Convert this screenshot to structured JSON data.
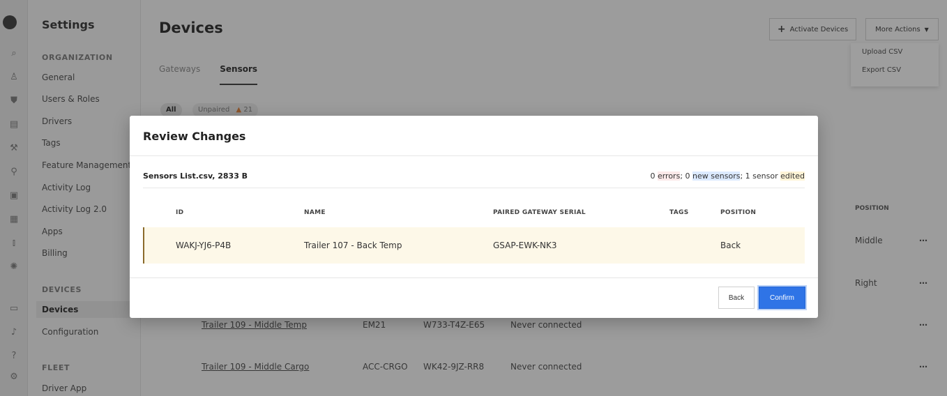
{
  "sidebar": {
    "title": "Settings",
    "organization_label": "ORGANIZATION",
    "org_items": [
      "General",
      "Users & Roles",
      "Drivers",
      "Tags",
      "Feature Management",
      "Activity Log",
      "Activity Log 2.0",
      "Apps",
      "Billing"
    ],
    "devices_label": "DEVICES",
    "device_items": [
      "Devices",
      "Configuration"
    ],
    "fleet_label": "FLEET",
    "fleet_items": [
      "Driver App"
    ]
  },
  "header": {
    "title": "Devices",
    "activate_label": "Activate Devices",
    "more_actions_label": "More Actions"
  },
  "more_actions_menu": [
    "Upload CSV",
    "Export CSV"
  ],
  "tabs": [
    "Gateways",
    "Sensors"
  ],
  "filters": {
    "all": "All",
    "unpaired": "Unpaired",
    "unpaired_count": "21"
  },
  "background_table": {
    "position_header": "POSITION",
    "rows": [
      {
        "name": "",
        "model": "",
        "gateway": "",
        "status": "",
        "position": "Middle"
      },
      {
        "name": "",
        "model": "",
        "gateway": "",
        "status": "",
        "position": "Right"
      },
      {
        "name": "Trailer 109 - Middle Temp",
        "model": "EM21",
        "gateway": "W733-T4Z-E65",
        "status": "Never connected",
        "position": ""
      },
      {
        "name": "Trailer 109 - Middle Cargo",
        "model": "ACC-CRGO",
        "gateway": "WK42-9JZ-RR8",
        "status": "Never connected",
        "position": ""
      }
    ]
  },
  "modal": {
    "title": "Review Changes",
    "file_name": "Sensors List.csv, 2833 B",
    "summary": {
      "errors_count": "0",
      "errors_word": "errors",
      "new_count": "0",
      "new_word": "new sensors",
      "edited_count": "1",
      "edited_prefix": "sensor",
      "edited_word": "edited"
    },
    "columns": [
      "ID",
      "NAME",
      "PAIRED GATEWAY SERIAL",
      "TAGS",
      "POSITION"
    ],
    "row": {
      "id": "WAKJ-YJ6-P4B",
      "name": "Trailer 107 - Back Temp",
      "gateway": "GSAP-EWK-NK3",
      "tags": "",
      "position": "Back"
    },
    "back_label": "Back",
    "confirm_label": "Confirm"
  },
  "colors": {
    "accent": "#2f74e6",
    "edited_row_bg": "#fdf8e8",
    "edited_row_border": "#8a6a2b"
  }
}
